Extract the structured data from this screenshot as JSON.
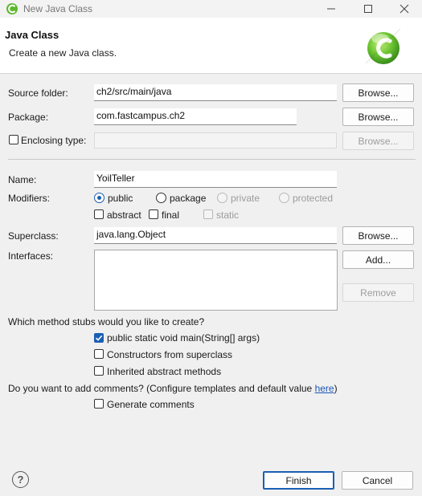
{
  "window": {
    "title": "New Java Class",
    "minimize_icon": "minimize-icon",
    "maximize_icon": "maximize-icon",
    "close_icon": "close-icon"
  },
  "header": {
    "title": "Java Class",
    "subtitle": "Create a new Java class.",
    "logo_icon": "new-class-wizard-icon"
  },
  "form": {
    "source_folder": {
      "label": "Source folder:",
      "value": "ch2/src/main/java",
      "browse": "Browse..."
    },
    "package": {
      "label": "Package:",
      "value": "com.fastcampus.ch2",
      "browse": "Browse..."
    },
    "enclosing": {
      "label": "Enclosing type:",
      "value": "",
      "checked": false,
      "browse": "Browse..."
    },
    "name": {
      "label": "Name:",
      "value": "YoilTeller"
    },
    "modifiers": {
      "label": "Modifiers:",
      "access": [
        "public",
        "package",
        "private",
        "protected"
      ],
      "selected": "public",
      "abstract": "abstract",
      "final": "final",
      "static": "static"
    },
    "superclass": {
      "label": "Superclass:",
      "value": "java.lang.Object",
      "browse": "Browse..."
    },
    "interfaces": {
      "label": "Interfaces:",
      "add": "Add...",
      "remove": "Remove"
    },
    "stubs": {
      "question": "Which method stubs would you like to create?",
      "main": "public static void main(String[] args)",
      "main_checked": true,
      "constructors": "Constructors from superclass",
      "inherited": "Inherited abstract methods"
    },
    "comments": {
      "question_prefix": "Do you want to add comments? (Configure templates and default value ",
      "link": "here",
      "question_suffix": ")",
      "generate": "Generate comments"
    }
  },
  "footer": {
    "help_glyph": "?",
    "finish": "Finish",
    "cancel": "Cancel"
  },
  "colors": {
    "accent": "#1a5fb4",
    "link": "#1b57b7",
    "logo_green": "#5cb82e"
  }
}
